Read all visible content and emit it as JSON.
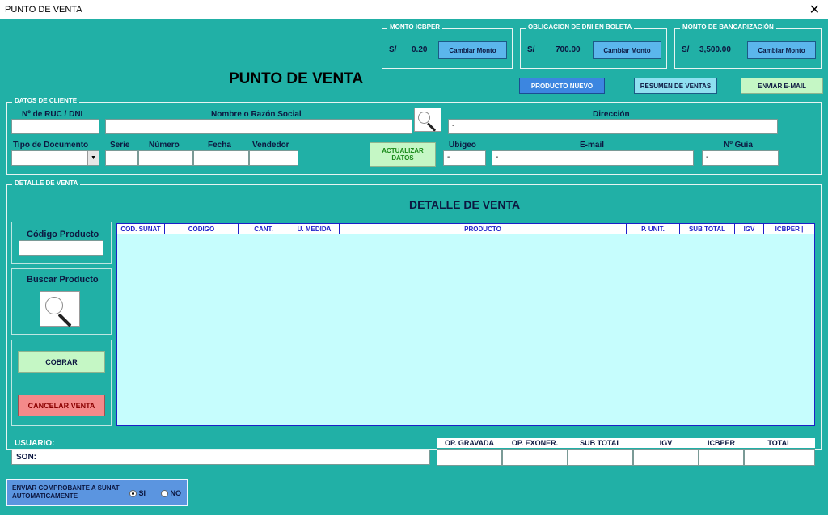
{
  "window": {
    "title": "PUNTO DE VENTA",
    "close_glyph": "✕"
  },
  "header": {
    "title": "PUNTO DE VENTA"
  },
  "icbper": {
    "legend": "MONTO ICBPER",
    "currency": "S/",
    "value": "0.20",
    "button": "Cambiar Monto"
  },
  "dni": {
    "legend": "OBLIGACION DE DNI EN BOLETA",
    "currency": "S/",
    "value": "700.00",
    "button": "Cambiar Monto"
  },
  "bancarizacion": {
    "legend": "MONTO DE BANCARIZACIÓN",
    "currency": "S/",
    "value": "3,500.00",
    "button": "Cambiar Monto"
  },
  "top_buttons": {
    "producto_nuevo": "PRODUCTO NUEVO",
    "resumen_ventas": "RESUMEN DE VENTAS",
    "enviar_email": "ENVIAR E-MAIL"
  },
  "cliente": {
    "legend": "DATOS DE CLIENTE",
    "ruc_label": "Nº de RUC / DNI",
    "ruc_value": "",
    "nombre_label": "Nombre o Razón Social",
    "nombre_value": "",
    "direccion_label": "Dirección",
    "direccion_value": "-",
    "tipo_doc_label": "Tipo de Documento",
    "tipo_doc_value": "",
    "serie_label": "Serie",
    "serie_value": "",
    "numero_label": "Número",
    "numero_value": "",
    "fecha_label": "Fecha",
    "fecha_value": "",
    "vendedor_label": "Vendedor",
    "vendedor_value": "",
    "actualizar_button": "ACTUALIZAR DATOS",
    "ubigeo_label": "Ubigeo",
    "ubigeo_value": "-",
    "email_label": "E-mail",
    "email_value": "-",
    "guia_label": "Nº Guia",
    "guia_value": "-"
  },
  "detalle": {
    "legend": "DETALLE DE VENTA",
    "title": "DETALLE DE VENTA",
    "codigo_producto_label": "Código Producto",
    "codigo_producto_value": "",
    "buscar_producto_label": "Buscar Producto",
    "cobrar_button": "COBRAR",
    "cancelar_button": "CANCELAR VENTA",
    "columns": [
      "COD. SUNAT",
      "CÓDIGO",
      "CANT.",
      "U. MEDIDA",
      "PRODUCTO",
      "P. UNIT.",
      "SUB TOTAL",
      "IGV",
      "ICBPER |"
    ]
  },
  "footer": {
    "usuario_label": "USUARIO:",
    "son_label": "SON:",
    "totals_columns": [
      "OP. GRAVADA",
      "OP. EXONER.",
      "SUB TOTAL",
      "IGV",
      "ICBPER",
      "TOTAL"
    ],
    "envio_label": "ENVIAR COMPROBANTE A SUNAT AUTOMATICAMENTE",
    "radio_si": "SI",
    "radio_no": "NO"
  },
  "icons": [
    "close-icon",
    "magnifier-icon",
    "dropdown-arrow-icon",
    "radio-icon"
  ],
  "colors": {
    "background": "#21b0a6",
    "grid_body": "#c6fdfd",
    "grid_border": "#1e1ec8",
    "accent_blue": "#3c86e0",
    "cobrar_green": "#c5f7c5",
    "cancel_red": "#f48a8a"
  }
}
